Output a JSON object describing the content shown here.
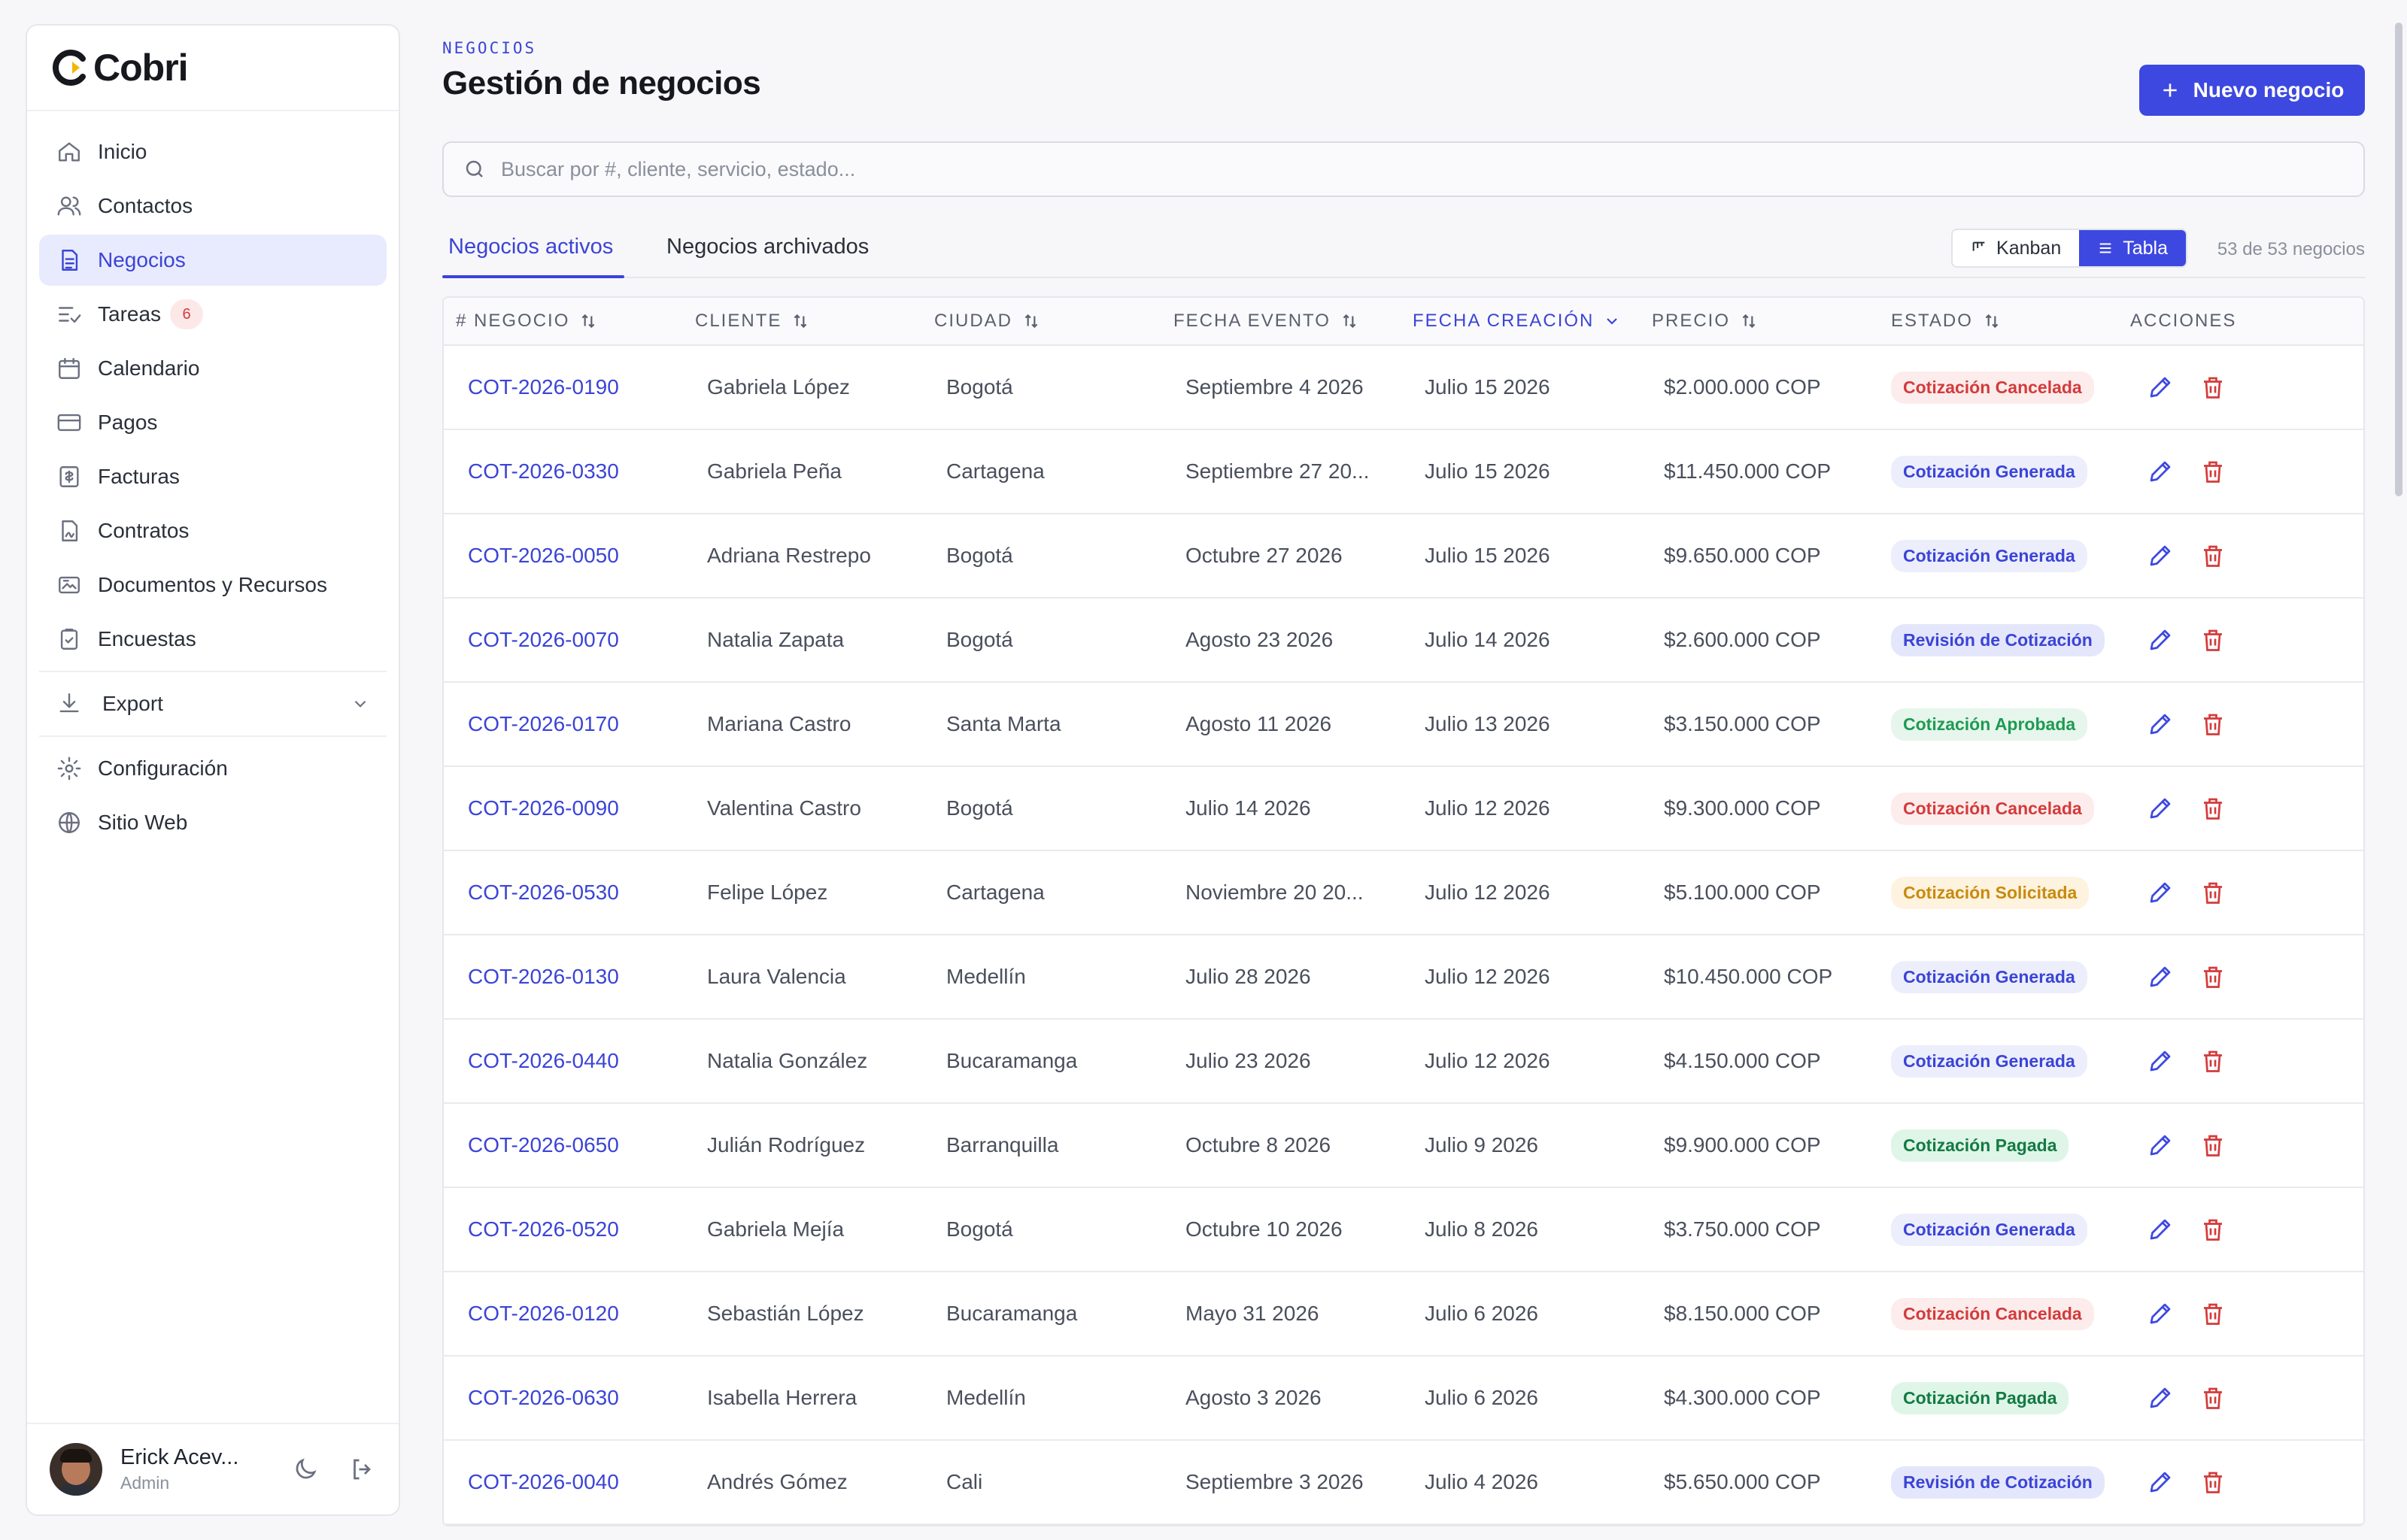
{
  "brand": {
    "name": "Cobri"
  },
  "sidebar": {
    "items": [
      {
        "label": "Inicio",
        "icon": "home-icon"
      },
      {
        "label": "Contactos",
        "icon": "users-icon"
      },
      {
        "label": "Negocios",
        "icon": "document-icon",
        "active": true
      },
      {
        "label": "Tareas",
        "icon": "tasks-icon",
        "badge": "6"
      },
      {
        "label": "Calendario",
        "icon": "calendar-icon"
      },
      {
        "label": "Pagos",
        "icon": "credit-card-icon"
      },
      {
        "label": "Facturas",
        "icon": "invoice-icon"
      },
      {
        "label": "Contratos",
        "icon": "contract-icon"
      },
      {
        "label": "Documentos y Recursos",
        "icon": "resources-icon"
      },
      {
        "label": "Encuestas",
        "icon": "clipboard-icon"
      }
    ],
    "export_label": "Export",
    "bottom_items": [
      {
        "label": "Configuración",
        "icon": "gear-icon"
      },
      {
        "label": "Sitio Web",
        "icon": "globe-icon"
      }
    ],
    "user": {
      "name": "Erick Acev...",
      "role": "Admin"
    }
  },
  "header": {
    "eyebrow": "NEGOCIOS",
    "title": "Gestión de negocios",
    "new_button": "Nuevo negocio"
  },
  "search": {
    "placeholder": "Buscar por #, cliente, servicio, estado..."
  },
  "tabs": [
    {
      "label": "Negocios activos",
      "active": true
    },
    {
      "label": "Negocios archivados",
      "active": false
    }
  ],
  "view_toggle": {
    "kanban": "Kanban",
    "table": "Tabla",
    "selected": "Tabla"
  },
  "count_text": "53 de 53 negocios",
  "table": {
    "columns": [
      "# NEGOCIO",
      "CLIENTE",
      "CIUDAD",
      "FECHA EVENTO",
      "FECHA CREACIÓN",
      "PRECIO",
      "ESTADO",
      "ACCIONES"
    ],
    "sorted_column": "FECHA CREACIÓN",
    "rows": [
      {
        "id": "COT-2026-0190",
        "cliente": "Gabriela López",
        "ciudad": "Bogotá",
        "evento": "Septiembre 4 2026",
        "creacion": "Julio 15 2026",
        "precio": "$2.000.000 COP",
        "estado": "Cotización Cancelada",
        "st": "cancel"
      },
      {
        "id": "COT-2026-0330",
        "cliente": "Gabriela Peña",
        "ciudad": "Cartagena",
        "evento": "Septiembre 27 20...",
        "creacion": "Julio 15 2026",
        "precio": "$11.450.000 COP",
        "estado": "Cotización Generada",
        "st": "gen"
      },
      {
        "id": "COT-2026-0050",
        "cliente": "Adriana Restrepo",
        "ciudad": "Bogotá",
        "evento": "Octubre 27 2026",
        "creacion": "Julio 15 2026",
        "precio": "$9.650.000 COP",
        "estado": "Cotización Generada",
        "st": "gen"
      },
      {
        "id": "COT-2026-0070",
        "cliente": "Natalia Zapata",
        "ciudad": "Bogotá",
        "evento": "Agosto 23 2026",
        "creacion": "Julio 14 2026",
        "precio": "$2.600.000 COP",
        "estado": "Revisión de Cotización",
        "st": "rev"
      },
      {
        "id": "COT-2026-0170",
        "cliente": "Mariana Castro",
        "ciudad": "Santa Marta",
        "evento": "Agosto 11 2026",
        "creacion": "Julio 13 2026",
        "precio": "$3.150.000 COP",
        "estado": "Cotización Aprobada",
        "st": "apr"
      },
      {
        "id": "COT-2026-0090",
        "cliente": "Valentina Castro",
        "ciudad": "Bogotá",
        "evento": "Julio 14 2026",
        "creacion": "Julio 12 2026",
        "precio": "$9.300.000 COP",
        "estado": "Cotización Cancelada",
        "st": "cancel"
      },
      {
        "id": "COT-2026-0530",
        "cliente": "Felipe López",
        "ciudad": "Cartagena",
        "evento": "Noviembre 20 20...",
        "creacion": "Julio 12 2026",
        "precio": "$5.100.000 COP",
        "estado": "Cotización Solicitada",
        "st": "sol"
      },
      {
        "id": "COT-2026-0130",
        "cliente": "Laura Valencia",
        "ciudad": "Medellín",
        "evento": "Julio 28 2026",
        "creacion": "Julio 12 2026",
        "precio": "$10.450.000 COP",
        "estado": "Cotización Generada",
        "st": "gen"
      },
      {
        "id": "COT-2026-0440",
        "cliente": "Natalia González",
        "ciudad": "Bucaramanga",
        "evento": "Julio 23 2026",
        "creacion": "Julio 12 2026",
        "precio": "$4.150.000 COP",
        "estado": "Cotización Generada",
        "st": "gen"
      },
      {
        "id": "COT-2026-0650",
        "cliente": "Julián Rodríguez",
        "ciudad": "Barranquilla",
        "evento": "Octubre 8 2026",
        "creacion": "Julio 9 2026",
        "precio": "$9.900.000 COP",
        "estado": "Cotización Pagada",
        "st": "pag"
      },
      {
        "id": "COT-2026-0520",
        "cliente": "Gabriela Mejía",
        "ciudad": "Bogotá",
        "evento": "Octubre 10 2026",
        "creacion": "Julio 8 2026",
        "precio": "$3.750.000 COP",
        "estado": "Cotización Generada",
        "st": "gen"
      },
      {
        "id": "COT-2026-0120",
        "cliente": "Sebastián López",
        "ciudad": "Bucaramanga",
        "evento": "Mayo 31 2026",
        "creacion": "Julio 6 2026",
        "precio": "$8.150.000 COP",
        "estado": "Cotización Cancelada",
        "st": "cancel"
      },
      {
        "id": "COT-2026-0630",
        "cliente": "Isabella Herrera",
        "ciudad": "Medellín",
        "evento": "Agosto 3 2026",
        "creacion": "Julio 6 2026",
        "precio": "$4.300.000 COP",
        "estado": "Cotización Pagada",
        "st": "pag"
      },
      {
        "id": "COT-2026-0040",
        "cliente": "Andrés Gómez",
        "ciudad": "Cali",
        "evento": "Septiembre 3 2026",
        "creacion": "Julio 4 2026",
        "precio": "$5.650.000 COP",
        "estado": "Revisión de Cotización",
        "st": "rev"
      }
    ]
  },
  "colors": {
    "accent": "#3d48e0",
    "danger": "#d33b3b",
    "success": "#1f9a52",
    "warning": "#c98a0e"
  }
}
